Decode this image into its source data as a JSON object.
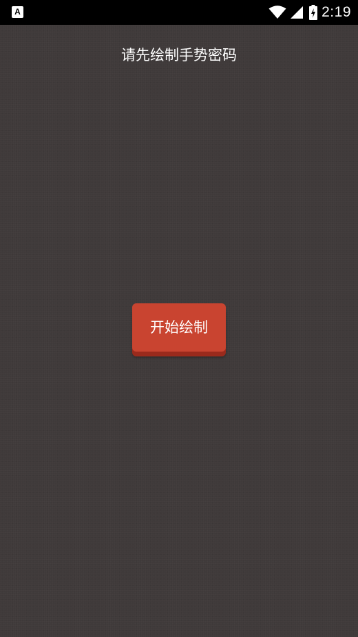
{
  "status_bar": {
    "notification_icon": "a-accessibility-icon",
    "wifi_icon": "wifi-icon",
    "signal_icon": "cell-signal-icon",
    "battery_icon": "battery-charging-icon",
    "time": "2:19"
  },
  "main": {
    "prompt": "请先绘制手势密码",
    "start_button_label": "开始绘制"
  },
  "colors": {
    "background": "#3f3a3a",
    "button": "#c94430",
    "button_shadow": "#9a2a1c",
    "status_bar": "#000000"
  }
}
